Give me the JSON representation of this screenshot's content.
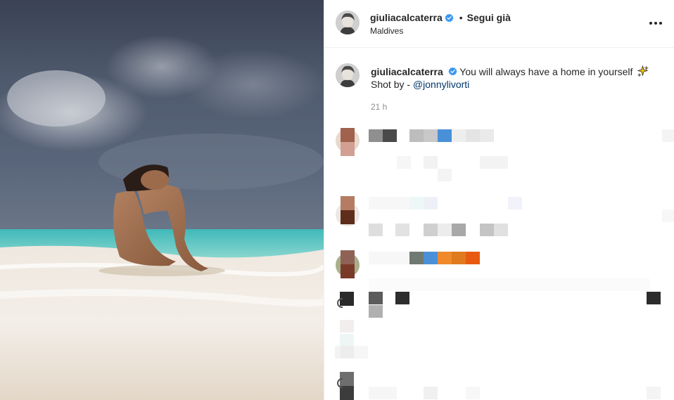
{
  "post": {
    "username": "giuliacalcaterra",
    "follow_label": "Segui già",
    "separator": "•",
    "location": "Maldives"
  },
  "caption": {
    "username": "giuliacalcaterra",
    "text": "You will always have a home in yourself",
    "shot_by_prefix": "Shot by - ",
    "mention": "@jonnylivorti",
    "time": "21 h"
  },
  "icons": {
    "verified": "verified-badge-icon",
    "more": "more-options-icon",
    "sparkle": "sparkles-emoji"
  },
  "colors": {
    "verified": "#3897f0",
    "mention": "#00376b",
    "muted": "#8e8e8e"
  }
}
